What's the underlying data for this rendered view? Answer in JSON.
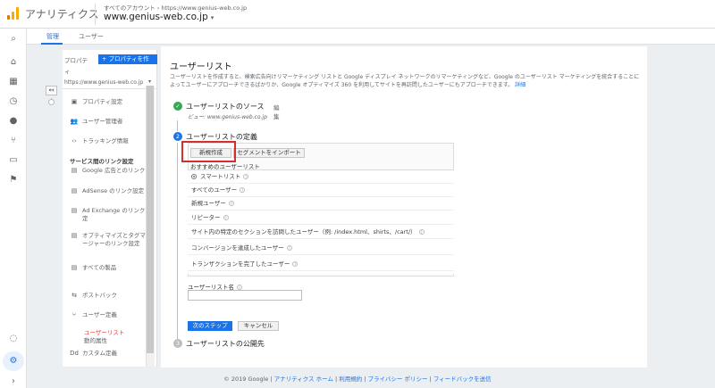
{
  "header": {
    "app_title": "アナリティクス",
    "breadcrumb": "すべてのアカウント › https://www.genius-web.co.jp",
    "property_name": "www.genius-web.co.jp",
    "property_caret": "▾"
  },
  "tabs": [
    {
      "label": "管理",
      "active": true
    },
    {
      "label": "ユーザー",
      "active": false
    }
  ],
  "sidebar": {
    "property_label": "プロパティ",
    "add_property_button": "+ プロパティを作",
    "property_url": "https://www.genius-web.co.jp",
    "items": [
      {
        "icon": "property-settings-icon",
        "label": "プロパティ設定"
      },
      {
        "icon": "user-management-icon",
        "label": "ユーザー管理者"
      },
      {
        "icon": "code-icon",
        "label": "トラッキング情報"
      }
    ],
    "section_heading": "サービス間のリンク設定",
    "links": [
      {
        "icon": "google-ads-icon",
        "label": "Google 広告とのリンク"
      },
      {
        "icon": "adsense-icon",
        "label": "AdSense のリンク設定"
      },
      {
        "icon": "ad-exchange-icon",
        "label": "Ad Exchange のリンク設定"
      },
      {
        "icon": "optimize-icon",
        "label": "オプティマイズとタグマネージャーのリンク設定"
      },
      {
        "icon": "products-icon",
        "label": "すべての製品"
      },
      {
        "icon": "postback-icon",
        "label": "ポストバック"
      },
      {
        "icon": "user-definition-icon",
        "label": "ユーザー定義"
      }
    ],
    "sub_items": [
      {
        "label": "ユーザーリスト",
        "active": true
      },
      {
        "label": "動的属性",
        "active": false
      }
    ],
    "custom_label": "カスタム定義",
    "custom_icon_text": "Dd"
  },
  "main": {
    "title": "ユーザーリスト",
    "description": "ユーザーリストを作成すると、検索広告向けリマーケティング リストと Google ディスプレイ ネットワークのリマーケティングなど、Google のユーザーリスト マーケティングを統合することによってユーザーにアプローチできるばかりか、Google オプティマイズ 360 を利用してサイトを再訪問したユーザーにもアプローチできます。",
    "description_link": "詳細",
    "step1": {
      "badge": "✓",
      "title": "ユーザーリストのソース",
      "edit": "編集",
      "view": "ビュー: www.genius-web.co.jp"
    },
    "step2": {
      "badge": "2",
      "title": "ユーザーリストの定義",
      "new_button": "新規作成",
      "import_button": "セグメントをインポート",
      "recommended_heading": "おすすめのユーザーリスト",
      "options": [
        {
          "label": "スマートリスト",
          "radio": true
        },
        {
          "label": "すべてのユーザー"
        },
        {
          "label": "新規ユーザー"
        },
        {
          "label": "リピーター"
        },
        {
          "label": "サイト内の特定のセクションを訪問したユーザー（例: /index.html、shirts、/cart/）"
        },
        {
          "label": "コンバージョンを達成したユーザー"
        },
        {
          "label": "トランザクションを完了したユーザー"
        }
      ],
      "name_label": "ユーザーリスト名",
      "name_value": "",
      "next_button": "次のステップ",
      "cancel_button": "キャンセル"
    },
    "step3": {
      "badge": "3",
      "title": "ユーザーリストの公開先"
    }
  },
  "footer": {
    "copyright": "© 2019 Google |",
    "links": [
      "アナリティクス ホーム",
      "利用規約",
      "プライバシー ポリシー",
      "フィードバックを送信"
    ]
  },
  "colors": {
    "accent": "#1a73e8",
    "highlight": "#d32f2f",
    "done": "#34a853"
  }
}
